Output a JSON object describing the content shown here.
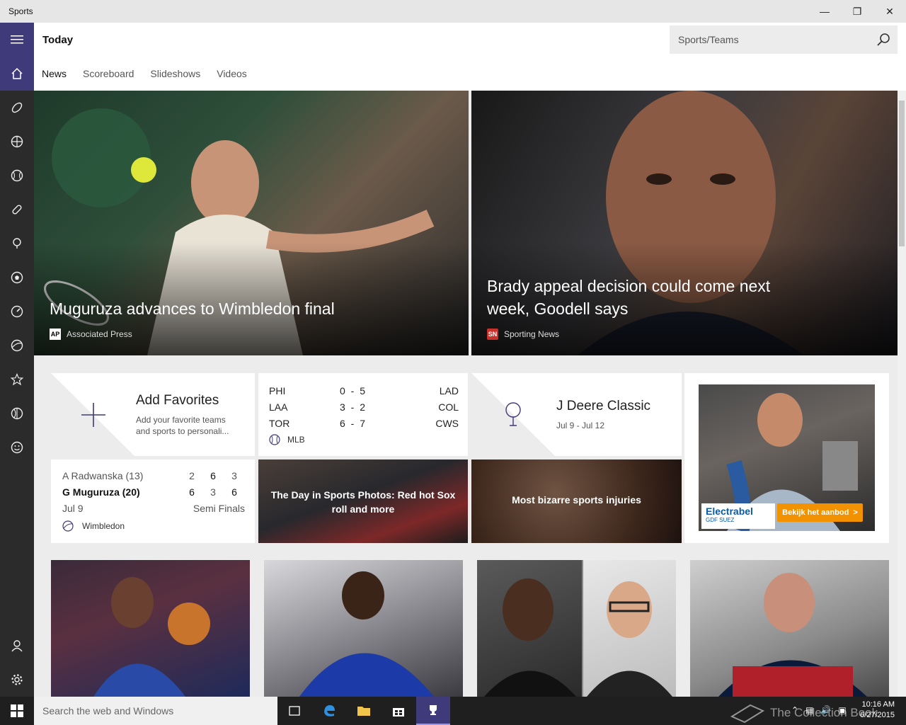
{
  "window": {
    "title": "Sports"
  },
  "header": {
    "page_title": "Today",
    "search_placeholder": "Sports/Teams"
  },
  "tabs": [
    {
      "label": "News"
    },
    {
      "label": "Scoreboard"
    },
    {
      "label": "Slideshows"
    },
    {
      "label": "Videos"
    }
  ],
  "rail": {
    "items": [
      "home-icon",
      "football-icon",
      "basketball-icon",
      "baseball-icon",
      "hockey-icon",
      "golf-icon",
      "soccer-icon",
      "racing-icon",
      "tennis-icon",
      "star-icon",
      "cricket-icon",
      "smiley-icon"
    ],
    "bottom": [
      "person-icon",
      "gear-icon"
    ]
  },
  "hero": [
    {
      "headline": "Muguruza advances to Wimbledon final",
      "source": "Associated Press",
      "source_logo": "AP"
    },
    {
      "headline": "Brady appeal decision could come next week, Goodell says",
      "source": "Sporting News",
      "source_logo": "SN"
    }
  ],
  "favorites": {
    "title": "Add Favorites",
    "desc": "Add your favorite teams and sports to personali..."
  },
  "mlb": {
    "rows": [
      {
        "home": "PHI",
        "score": "0 - 5",
        "away": "LAD"
      },
      {
        "home": "LAA",
        "score": "3 - 2",
        "away": "COL"
      },
      {
        "home": "TOR",
        "score": "6 - 7",
        "away": "CWS"
      }
    ],
    "league": "MLB"
  },
  "golf": {
    "title": "J Deere Classic",
    "dates": "Jul 9 - Jul 12"
  },
  "tennis": {
    "p1": "A Radwanska (13)",
    "p1_sets": [
      "2",
      "6",
      "3"
    ],
    "p2": "G Muguruza (20)",
    "p2_sets": [
      "6",
      "3",
      "6"
    ],
    "date": "Jul 9",
    "round": "Semi Finals",
    "event": "Wimbledon"
  },
  "photo_tiles": [
    {
      "caption": "The Day in Sports Photos: Red hot Sox roll and more"
    },
    {
      "caption": "Most bizarre sports injuries"
    }
  ],
  "ad": {
    "brand": "Electrabel",
    "brand_sub": "GDF SUEZ",
    "cta": "Bekijk het aanbod  >"
  },
  "taskbar": {
    "search": "Search the web and Windows",
    "time": "10:16 AM",
    "date": "6/27/2015",
    "watermark": "The Collection Book"
  },
  "colors": {
    "accent": "#3f3a7a",
    "rail": "#2b2b2b",
    "ad_orange": "#f29200",
    "ad_blue": "#0a5aa8"
  }
}
